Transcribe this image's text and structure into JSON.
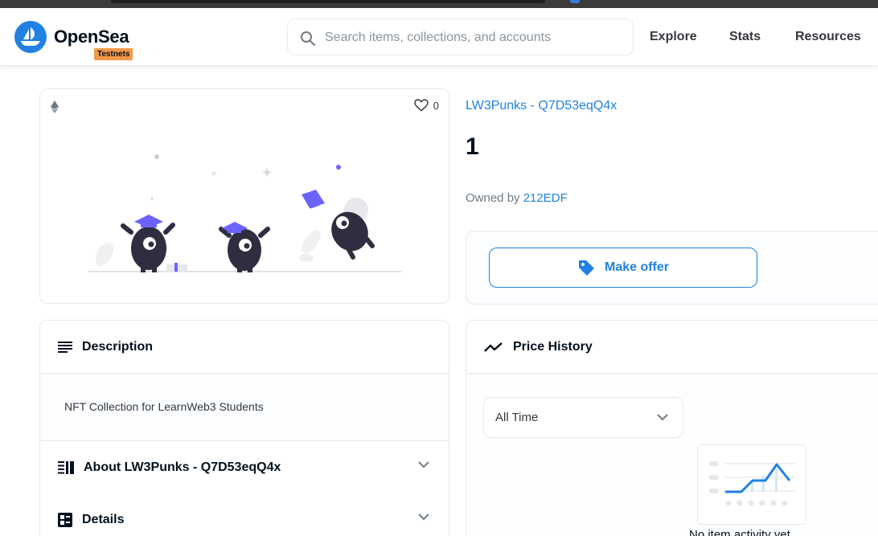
{
  "header": {
    "brand": "OpenSea",
    "badge": "Testnets",
    "search_placeholder": "Search items, collections, and accounts",
    "nav": [
      "Explore",
      "Stats",
      "Resources"
    ]
  },
  "item": {
    "favorites_count": "0",
    "collection_name": "LW3Punks - Q7D53eqQ4x",
    "token_name": "1",
    "owned_by_label": "Owned by",
    "owner": "212EDF",
    "make_offer_label": "Make offer"
  },
  "panels": {
    "description_title": "Description",
    "description_text": "NFT Collection for LearnWeb3 Students",
    "about_title": "About LW3Punks - Q7D53eqQ4x",
    "details_title": "Details",
    "price_history_title": "Price History",
    "time_filter": "All Time",
    "empty_activity": "No item activity yet"
  },
  "colors": {
    "accent": "#2081e2",
    "badge": "#f2994a",
    "text": "#04111d",
    "muted": "#707a83"
  },
  "icons": [
    "opensea-logo-icon",
    "search-icon",
    "ethereum-icon",
    "heart-icon",
    "tag-icon",
    "list-icon",
    "about-icon",
    "details-icon",
    "chevron-down-icon",
    "trend-icon"
  ]
}
